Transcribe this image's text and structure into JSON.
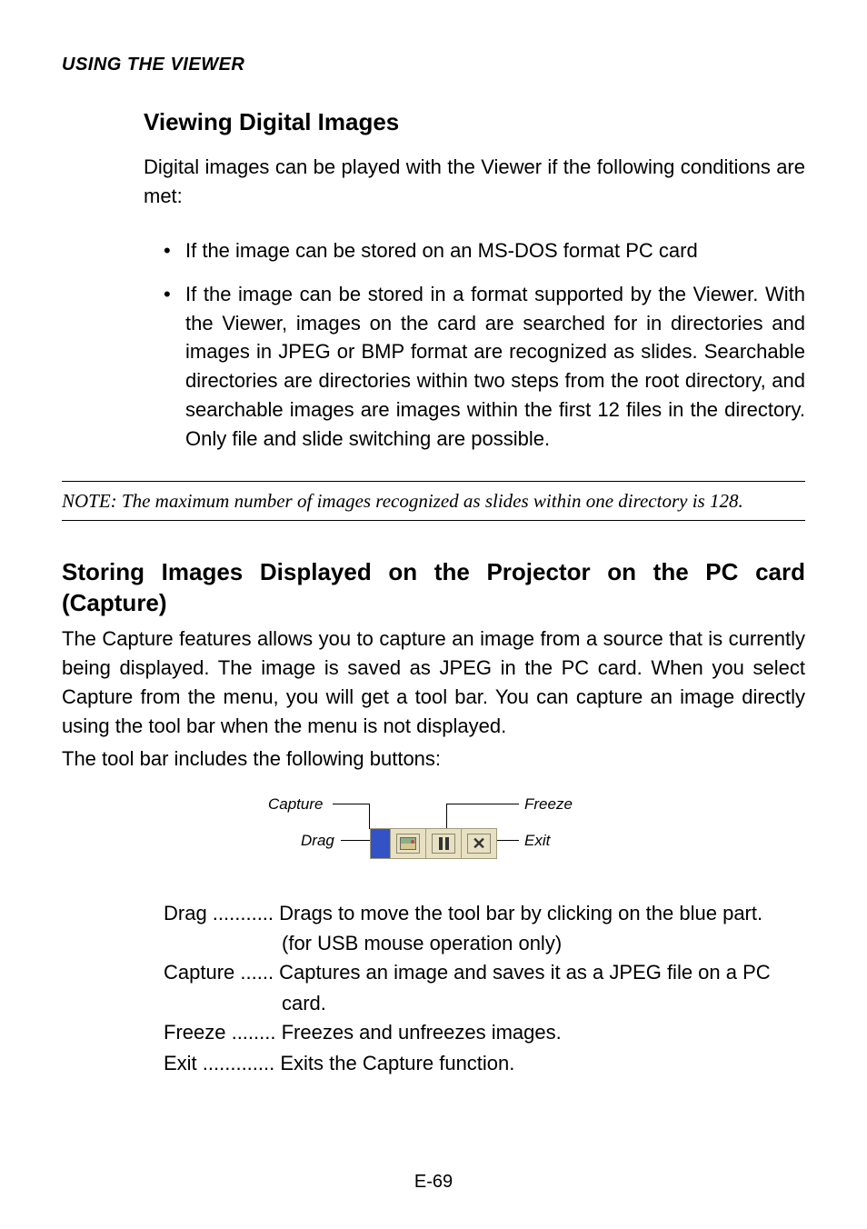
{
  "section_header": "USING THE VIEWER",
  "h1": "Viewing Digital Images",
  "intro_para": "Digital images can be played with the Viewer if the following conditions are met:",
  "bullets": [
    "If the image can be stored on an MS-DOS format PC card",
    "If the image can be stored in a format supported by the Viewer. With the Viewer, images on the card are searched for in directories and images in JPEG or BMP format are recognized as slides. Searchable directories are directories within two steps from the root directory, and searchable images are images within the first 12 files in the directory. Only file and slide switching are possible."
  ],
  "note": "NOTE: The maximum number of images recognized as slides within one directory is 128.",
  "h2": "Storing Images Displayed on the Projector on the PC card (Capture)",
  "capture_para": "The Capture features allows you to capture an image from a source that is currently being displayed. The image is saved as JPEG in the PC card. When you select Capture from the menu, you will get a tool bar. You can capture an image directly using the tool bar when the menu is not displayed.",
  "toolbar_intro": "The tool bar includes the following buttons:",
  "toolbar_labels": {
    "capture": "Capture",
    "drag": "Drag",
    "freeze": "Freeze",
    "exit": "Exit"
  },
  "definitions": [
    {
      "label": "Drag ........... ",
      "desc_line1": "Drags to move the tool bar by clicking on the blue part.",
      "desc_line2": "(for USB mouse operation only)"
    },
    {
      "label": "Capture ...... ",
      "desc_line1": "Captures an image and saves it as a JPEG file on a PC",
      "desc_line2": "card."
    },
    {
      "label": "Freeze ........ ",
      "desc_line1": "Freezes and unfreezes images.",
      "desc_line2": ""
    },
    {
      "label": "Exit ............. ",
      "desc_line1": "Exits the Capture function.",
      "desc_line2": ""
    }
  ],
  "page_num": "E-69"
}
